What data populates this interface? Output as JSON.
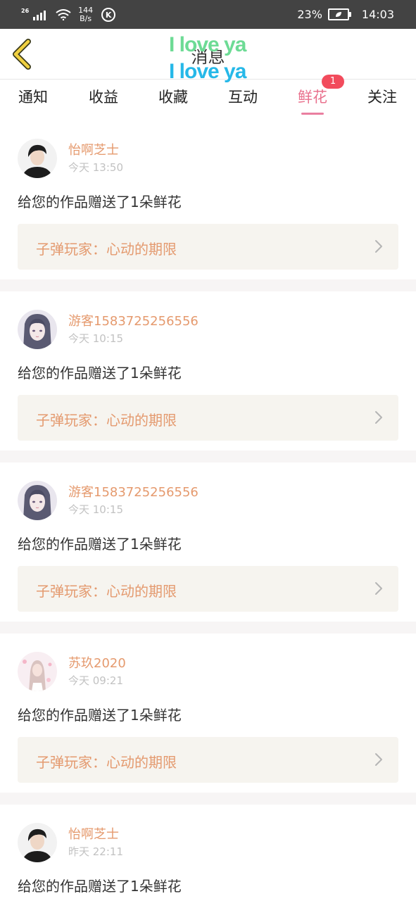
{
  "status_bar": {
    "network": "26",
    "speed_value": "144",
    "speed_unit": "B/s",
    "k_label": "K",
    "battery_percent": "23%",
    "time": "14:03",
    "icons": [
      "signal-icon",
      "wifi-icon",
      "k-app-icon",
      "battery-icon"
    ]
  },
  "header": {
    "title": "消息",
    "sticker_line1": "I love ya",
    "sticker_line2": "I love ya",
    "back_icon": "chevron-left-icon",
    "colors": {
      "back_icon": "#f0d040",
      "sticker1": "#6ddb95",
      "sticker2": "#26b8e8"
    }
  },
  "tabs": [
    {
      "label": "通知"
    },
    {
      "label": "收益"
    },
    {
      "label": "收藏"
    },
    {
      "label": "互动"
    },
    {
      "label": "鲜花",
      "active": true,
      "badge": "1"
    },
    {
      "label": "关注"
    }
  ],
  "colors": {
    "accent_tab": "#e9728e",
    "username": "#e59a6e",
    "work_title": "#e49a6f",
    "badge": "#f24b5c",
    "separator": "#f7f5f5",
    "work_bg": "#f6f4ef"
  },
  "messages": [
    {
      "username": "怡啊芝士",
      "time": "今天 13:50",
      "text": "给您的作品赠送了1朵鲜花",
      "work": "子弹玩家：心动的期限",
      "avatar": "boy"
    },
    {
      "username": "游客1583725256556",
      "time": "今天 10:15",
      "text": "给您的作品赠送了1朵鲜花",
      "work": "子弹玩家：心动的期限",
      "avatar": "anime"
    },
    {
      "username": "游客1583725256556",
      "time": "今天 10:15",
      "text": "给您的作品赠送了1朵鲜花",
      "work": "子弹玩家：心动的期限",
      "avatar": "anime"
    },
    {
      "username": "苏玖2020",
      "time": "今天 09:21",
      "text": "给您的作品赠送了1朵鲜花",
      "work": "子弹玩家：心动的期限",
      "avatar": "pink"
    },
    {
      "username": "怡啊芝士",
      "time": "昨天 22:11",
      "text": "给您的作品赠送了1朵鲜花",
      "work": "",
      "avatar": "boy"
    }
  ]
}
